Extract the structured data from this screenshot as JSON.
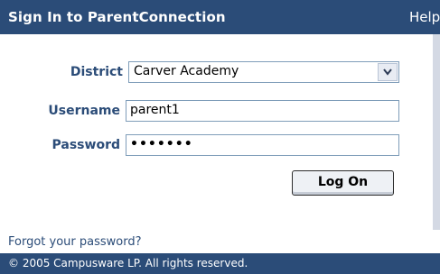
{
  "header": {
    "title": "Sign In to ParentConnection",
    "help_label": "Help"
  },
  "form": {
    "district_label": "District",
    "district_value": "Carver Academy",
    "username_label": "Username",
    "username_value": "parent1",
    "password_label": "Password",
    "password_masked": "•••••••",
    "logon_label": "Log On"
  },
  "links": {
    "forgot_password": "Forgot your password?"
  },
  "footer": {
    "copyright": "© 2005 Campusware LP. All rights reserved."
  },
  "colors": {
    "brand": "#2b4c78",
    "field_border": "#7f9db9"
  },
  "icons": {
    "dropdown": "chevron-down-icon"
  }
}
